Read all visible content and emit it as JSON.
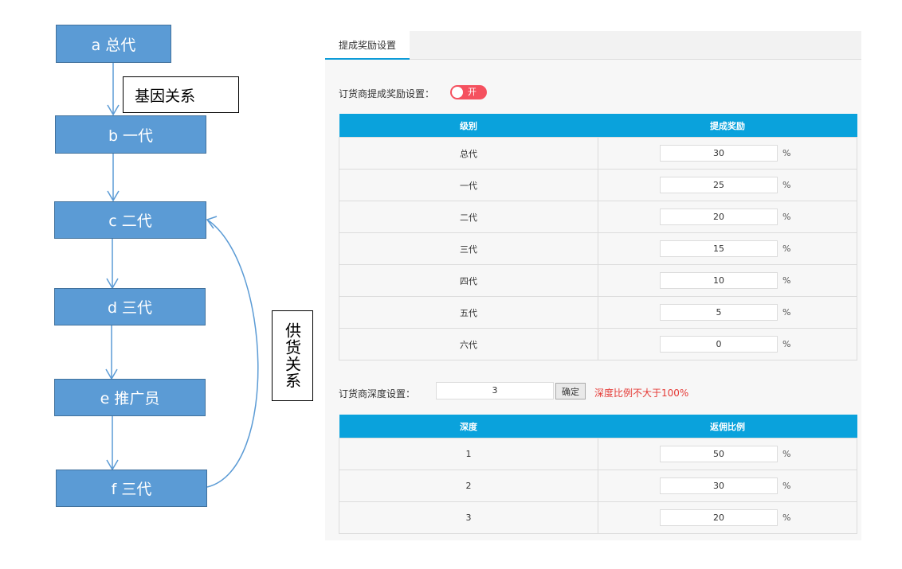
{
  "diagram": {
    "nodes": [
      "a 总代",
      "b 一代",
      "c 二代",
      "d 三代",
      "e 推广员",
      "f 三代"
    ],
    "gene_label": "基因关系",
    "supply_label": "供货关系",
    "colors": {
      "node_fill": "#5b9bd5",
      "arrow": "#5b9bd5"
    }
  },
  "panel": {
    "tab": "提成奖励设置",
    "reward_label": "订货商提成奖励设置：",
    "toggle_text": "开",
    "reward_table": {
      "headers": [
        "级别",
        "提成奖励"
      ],
      "rows": [
        {
          "level": "总代",
          "value": "30"
        },
        {
          "level": "一代",
          "value": "25"
        },
        {
          "level": "二代",
          "value": "20"
        },
        {
          "level": "三代",
          "value": "15"
        },
        {
          "level": "四代",
          "value": "10"
        },
        {
          "level": "五代",
          "value": "5"
        },
        {
          "level": "六代",
          "value": "0"
        }
      ]
    },
    "unit": "%",
    "depth_label": "订货商深度设置：",
    "depth_value": "3",
    "confirm": "确定",
    "warning": "深度比例不大于100%",
    "depth_table": {
      "headers": [
        "深度",
        "返佣比例"
      ],
      "rows": [
        {
          "depth": "1",
          "value": "50"
        },
        {
          "depth": "2",
          "value": "30"
        },
        {
          "depth": "3",
          "value": "20"
        }
      ]
    },
    "colors": {
      "header": "#0aa2dc",
      "toggle": "#f5515f",
      "warning": "#e53935"
    }
  }
}
